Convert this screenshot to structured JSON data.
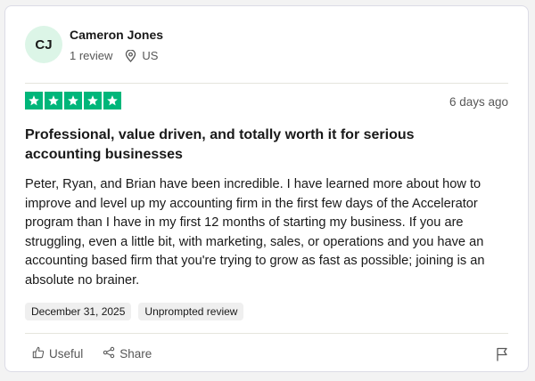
{
  "reviewer": {
    "initials": "CJ",
    "name": "Cameron Jones",
    "reviews": "1 review",
    "country": "US"
  },
  "review": {
    "rating": 5,
    "date_ago": "6 days ago",
    "title": "Professional, value driven, and totally worth it for serious accounting businesses",
    "body": "Peter, Ryan, and Brian have been incredible. I have learned more about how to improve and level up my accounting firm in the first few days of the Accelerator program than I have in my first 12 months of starting my business. If you are struggling, even a little bit, with marketing, sales, or operations and you have an accounting based firm that you're trying to grow as fast as possible; joining is an absolute no brainer.",
    "date_of_experience": "December 31, 2025",
    "tag": "Unprompted review"
  },
  "actions": {
    "useful_label": "Useful",
    "share_label": "Share"
  },
  "colors": {
    "star_green": "#00b67a",
    "avatar_bg": "#dcf5e7"
  },
  "icons": [
    "map-pin-icon",
    "star-icon",
    "thumbs-up-icon",
    "share-icon",
    "flag-icon"
  ]
}
